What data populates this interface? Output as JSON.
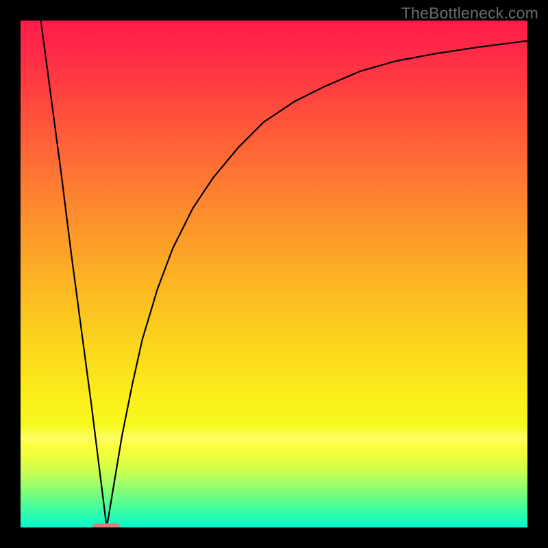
{
  "watermark": "TheBottleneck.com",
  "chart_data": {
    "type": "line",
    "title": "",
    "xlabel": "",
    "ylabel": "",
    "xlim": [
      0,
      100
    ],
    "ylim": [
      0,
      100
    ],
    "grid": false,
    "background_gradient": {
      "top": "#ff1a4a",
      "bottom": "#05facc",
      "description": "vertical red→orange→yellow→green gradient"
    },
    "series": [
      {
        "name": "bottleneck-curve",
        "x": [
          4,
          6,
          8,
          10,
          12,
          14,
          16,
          17.0,
          18,
          20,
          22,
          24,
          27,
          30,
          34,
          38,
          43,
          48,
          54,
          60,
          67,
          74,
          82,
          90,
          100
        ],
        "y": [
          100,
          85,
          70,
          54,
          39,
          24,
          8,
          0,
          6,
          18,
          28,
          37,
          47,
          55,
          63,
          69,
          75,
          80,
          84,
          87,
          90,
          92,
          93.5,
          94.7,
          96
        ],
        "note": "V-shaped curve: steep linear descent then logarithmic rise"
      }
    ],
    "annotations": [
      {
        "name": "optimal-marker",
        "type": "pill",
        "x_center": 17.0,
        "y": 0,
        "width_pct": 5.5,
        "color": "#d67f7d"
      }
    ]
  }
}
